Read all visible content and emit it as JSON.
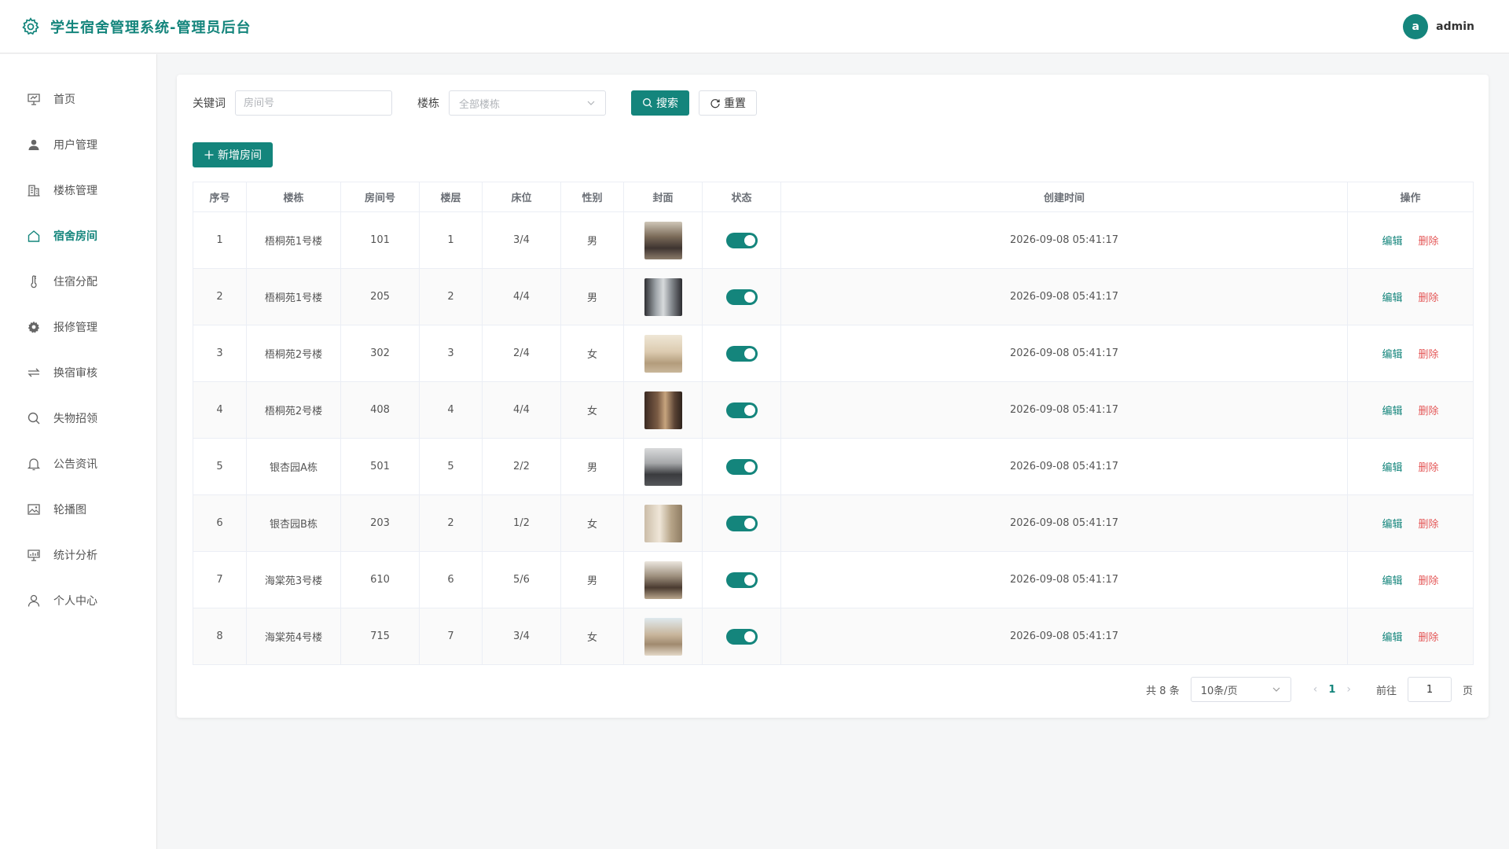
{
  "app": {
    "title": "学生宿舍管理系统-管理员后台"
  },
  "user": {
    "avatar_letter": "a",
    "name": "admin"
  },
  "sidebar": {
    "items": [
      {
        "label": "首页",
        "icon": "dashboard-icon",
        "active": false
      },
      {
        "label": "用户管理",
        "icon": "user-icon",
        "active": false
      },
      {
        "label": "楼栋管理",
        "icon": "building-icon",
        "active": false
      },
      {
        "label": "宿舍房间",
        "icon": "home-icon",
        "active": true
      },
      {
        "label": "住宿分配",
        "icon": "thermometer-icon",
        "active": false
      },
      {
        "label": "报修管理",
        "icon": "gear-icon",
        "active": false
      },
      {
        "label": "换宿审核",
        "icon": "swap-icon",
        "active": false
      },
      {
        "label": "失物招领",
        "icon": "search-icon",
        "active": false
      },
      {
        "label": "公告资讯",
        "icon": "bell-icon",
        "active": false
      },
      {
        "label": "轮播图",
        "icon": "picture-icon",
        "active": false
      },
      {
        "label": "统计分析",
        "icon": "chart-icon",
        "active": false
      },
      {
        "label": "个人中心",
        "icon": "person-icon",
        "active": false
      }
    ]
  },
  "filter": {
    "keyword_label": "关键词",
    "keyword_placeholder": "房间号",
    "building_label": "楼栋",
    "building_placeholder": "全部楼栋",
    "search_label": "搜索",
    "reset_label": "重置"
  },
  "add_button_label": "新增房间",
  "table": {
    "headers": [
      "序号",
      "楼栋",
      "房间号",
      "楼层",
      "床位",
      "性别",
      "封面",
      "状态",
      "创建时间",
      "操作"
    ],
    "rows": [
      {
        "idx": "1",
        "building": "梧桐苑1号楼",
        "room": "101",
        "floor": "1",
        "beds": "3/4",
        "gender": "男",
        "status_on": true,
        "created": "2026-09-08 05:41:17"
      },
      {
        "idx": "2",
        "building": "梧桐苑1号楼",
        "room": "205",
        "floor": "2",
        "beds": "4/4",
        "gender": "男",
        "status_on": true,
        "created": "2026-09-08 05:41:17"
      },
      {
        "idx": "3",
        "building": "梧桐苑2号楼",
        "room": "302",
        "floor": "3",
        "beds": "2/4",
        "gender": "女",
        "status_on": true,
        "created": "2026-09-08 05:41:17"
      },
      {
        "idx": "4",
        "building": "梧桐苑2号楼",
        "room": "408",
        "floor": "4",
        "beds": "4/4",
        "gender": "女",
        "status_on": true,
        "created": "2026-09-08 05:41:17"
      },
      {
        "idx": "5",
        "building": "银杏园A栋",
        "room": "501",
        "floor": "5",
        "beds": "2/2",
        "gender": "男",
        "status_on": true,
        "created": "2026-09-08 05:41:17"
      },
      {
        "idx": "6",
        "building": "银杏园B栋",
        "room": "203",
        "floor": "2",
        "beds": "1/2",
        "gender": "女",
        "status_on": true,
        "created": "2026-09-08 05:41:17"
      },
      {
        "idx": "7",
        "building": "海棠苑3号楼",
        "room": "610",
        "floor": "6",
        "beds": "5/6",
        "gender": "男",
        "status_on": true,
        "created": "2026-09-08 05:41:17"
      },
      {
        "idx": "8",
        "building": "海棠苑4号楼",
        "room": "715",
        "floor": "7",
        "beds": "3/4",
        "gender": "女",
        "status_on": true,
        "created": "2026-09-08 05:41:17"
      }
    ],
    "edit_label": "编辑",
    "delete_label": "删除"
  },
  "pagination": {
    "total_text": "共 8 条",
    "page_size": "10条/页",
    "current_page": "1",
    "goto_label": "前往",
    "goto_value": "1",
    "page_unit": "页"
  },
  "colors": {
    "accent": "#14857c",
    "danger": "#e45757"
  }
}
